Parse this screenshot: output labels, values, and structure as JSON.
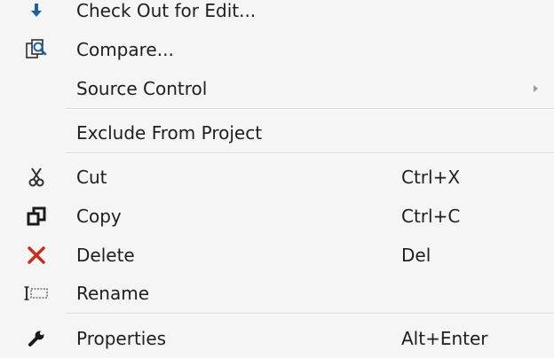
{
  "menu": {
    "items": [
      {
        "label": "Check Out for Edit...",
        "icon": "check-out-down-arrow-icon"
      },
      {
        "label": "Compare...",
        "icon": "compare-magnifier-icon"
      },
      {
        "label": "Source Control",
        "submenu": true
      },
      {
        "label": "Exclude From Project"
      },
      {
        "label": "Cut",
        "shortcut": "Ctrl+X",
        "icon": "scissors-icon"
      },
      {
        "label": "Copy",
        "shortcut": "Ctrl+C",
        "icon": "copy-icon"
      },
      {
        "label": "Delete",
        "shortcut": "Del",
        "icon": "delete-x-icon"
      },
      {
        "label": "Rename",
        "icon": "rename-icon"
      },
      {
        "label": "Properties",
        "shortcut": "Alt+Enter",
        "icon": "wrench-icon"
      }
    ]
  },
  "colors": {
    "background": "#f5f5f5",
    "text": "#1e1e1e",
    "check_out_arrow": "#1f5fa8",
    "delete_x": "#c5301b",
    "separator": "#d9d9d9"
  }
}
